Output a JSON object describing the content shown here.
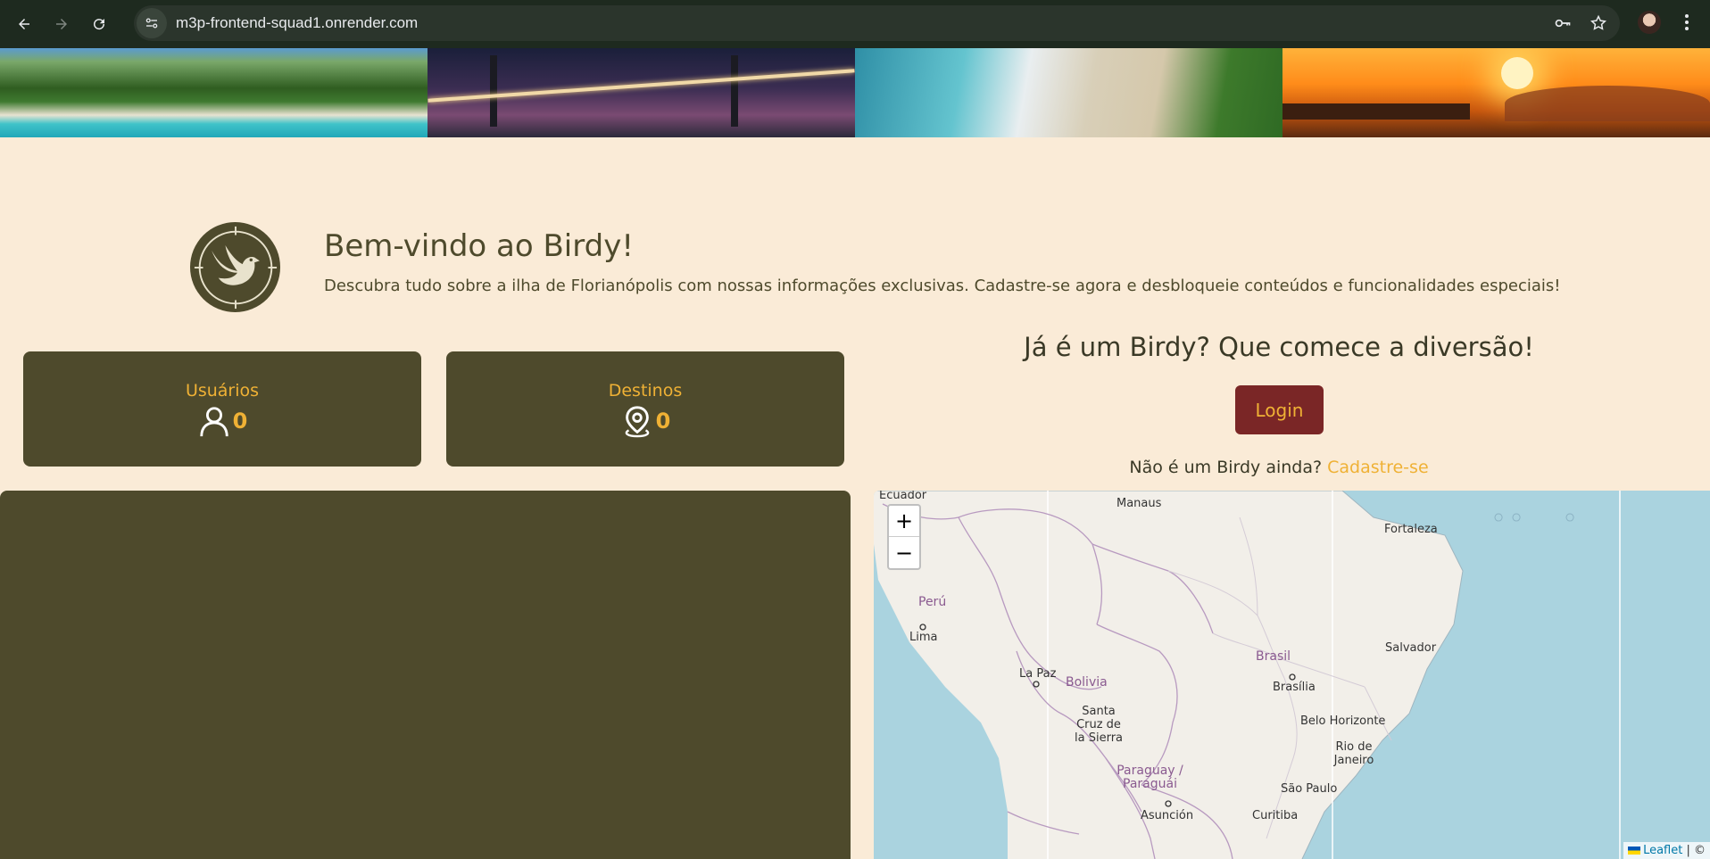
{
  "browser": {
    "url": "m3p-frontend-squad1.onrender.com",
    "icons": [
      "back-icon",
      "forward-icon",
      "reload-icon",
      "site-settings-icon",
      "password-key-icon",
      "bookmark-star-icon",
      "profile-avatar",
      "menu-kebab-icon"
    ]
  },
  "banner": {
    "images": [
      "beach-island-photo",
      "bridge-night-photo",
      "aerial-beach-photo",
      "sunset-pier-photo"
    ]
  },
  "welcome": {
    "title": "Bem-vindo ao Birdy!",
    "text": "Descubra tudo sobre a ilha de Florianópolis com nossas informações exclusivas. Cadastre-se agora e desbloqueie conteúdos e funcionalidades especiais!"
  },
  "stats": {
    "users": {
      "label": "Usuários",
      "value": "0"
    },
    "destinations": {
      "label": "Destinos",
      "value": "0"
    }
  },
  "login": {
    "title": "Já é um Birdy? Que comece a diversão!",
    "button": "Login",
    "signup_prompt": "Não é um Birdy ainda?",
    "signup_link": "Cadastre-se"
  },
  "map": {
    "zoom_in": "+",
    "zoom_out": "−",
    "attribution_link": "Leaflet",
    "attribution_rest": " | ©",
    "labels": {
      "ecuador": "Ecuador",
      "manaus": "Manaus",
      "fortaleza": "Fortaleza",
      "peru": "Perú",
      "lima": "Lima",
      "salvador": "Salvador",
      "brasil": "Brasil",
      "brasilia": "Brasília",
      "la_paz": "La Paz",
      "bolivia": "Bolivia",
      "santa_cruz": "Santa Cruz de la Sierra",
      "belo_horizonte": "Belo Horizonte",
      "rio": "Rio de Janeiro",
      "paraguay": "Paraguay / Paraguái",
      "sao_paulo": "São Paulo",
      "asuncion": "Asunción",
      "curitiba": "Curitiba"
    }
  },
  "colors": {
    "background": "#faebd7",
    "olive": "#4e4a2c",
    "gold": "#efb135",
    "burgundy": "#7a2626",
    "ocean": "#aad3df",
    "land": "#f2efe9"
  }
}
